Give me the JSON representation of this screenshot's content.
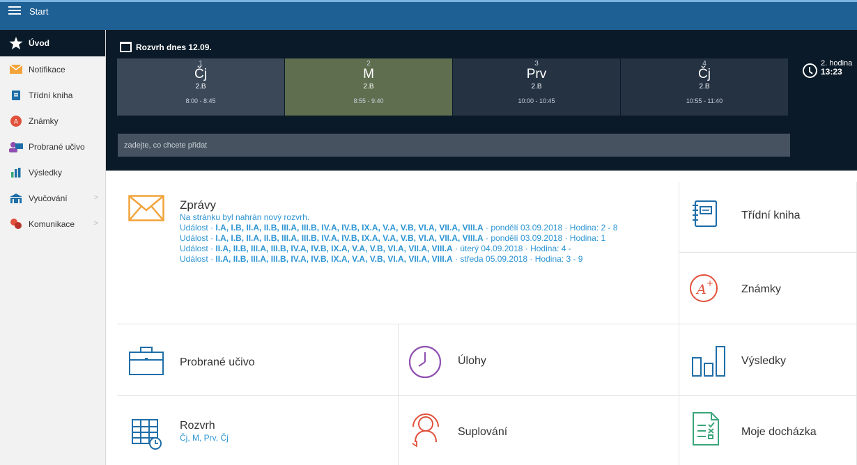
{
  "topbar": {
    "title": "Start"
  },
  "sidebar": {
    "items": [
      {
        "label": "Úvod"
      },
      {
        "label": "Notifikace"
      },
      {
        "label": "Třídní kniha"
      },
      {
        "label": "Známky"
      },
      {
        "label": "Probrané učivo"
      },
      {
        "label": "Výsledky"
      },
      {
        "label": "Vyučování",
        "chevron": ">"
      },
      {
        "label": "Komunikace",
        "chevron": ">"
      }
    ]
  },
  "schedule": {
    "title": "Rozvrh dnes 12.09.",
    "lessons": [
      {
        "n": "1",
        "subject": "Čj",
        "class": "2.B",
        "time": "8:00 - 8:45"
      },
      {
        "n": "2",
        "subject": "M",
        "class": "2.B",
        "time": "8:55 - 9:40"
      },
      {
        "n": "3",
        "subject": "Prv",
        "class": "2.B",
        "time": "10:00 - 10:45"
      },
      {
        "n": "4",
        "subject": "Čj",
        "class": "2.B",
        "time": "10:55 - 11:40"
      }
    ],
    "clock": {
      "label": "2. hodina",
      "time": "13:23"
    },
    "add_placeholder": "zadejte, co chcete přidat"
  },
  "tiles": {
    "zpravy": {
      "title": "Zprávy",
      "line0": "Na stránku byl nahrán nový rozvrh.",
      "events": [
        {
          "prefix": "Událost · ",
          "classes": "I.A, I.B, II.A, II.B, III.A, III.B, IV.A, IV.B, IX.A, V.A, V.B, VI.A, VII.A, VIII.A",
          "suffix": " · pondělí 03.09.2018 · Hodina: 2 - 8"
        },
        {
          "prefix": "Událost · ",
          "classes": "I.A, I.B, II.A, II.B, III.A, III.B, IV.A, IV.B, IX.A, V.A, V.B, VI.A, VII.A, VIII.A",
          "suffix": " · pondělí 03.09.2018 · Hodina: 1"
        },
        {
          "prefix": "Událost · ",
          "classes": "II.A, II.B, III.A, III.B, IV.A, IV.B, IX.A, V.A, V.B, VI.A, VII.A, VIII.A",
          "suffix": " · úterý 04.09.2018 · Hodina: 4 -"
        },
        {
          "prefix": "Událost · ",
          "classes": "II.A, II.B, III.A, III.B, IV.A, IV.B, IX.A, V.A, V.B, VI.A, VII.A, VIII.A",
          "suffix": " · středa 05.09.2018 · Hodina: 3 - 9"
        }
      ]
    },
    "tridni_kniha": {
      "title": "Třídní kniha"
    },
    "znamky": {
      "title": "Známky"
    },
    "probrane_ucivo": {
      "title": "Probrané učivo"
    },
    "ulohy": {
      "title": "Úlohy"
    },
    "vysledky": {
      "title": "Výsledky"
    },
    "rozvrh": {
      "title": "Rozvrh",
      "subtitle": "Čj, M, Prv, Čj"
    },
    "suplovani": {
      "title": "Suplování"
    },
    "dochazka": {
      "title": "Moje docházka"
    }
  },
  "colors": {
    "accent": "#2e95d3",
    "header": "#0b1a28",
    "topbar": "#1e5f94",
    "orange": "#f2a33a",
    "red": "#e0503a",
    "purple": "#8e4fb0",
    "green": "#3aa67a",
    "blue": "#1e6ea8"
  }
}
